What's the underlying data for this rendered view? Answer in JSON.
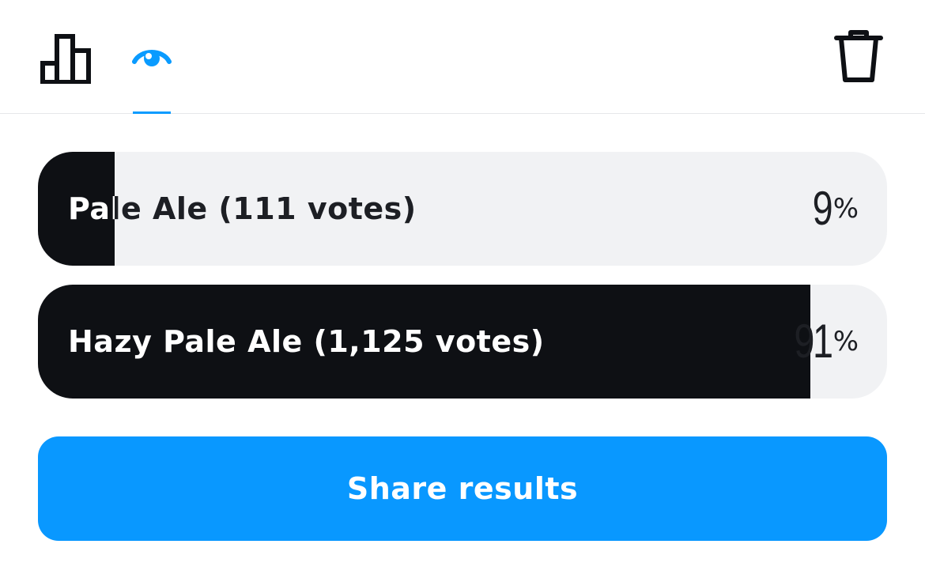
{
  "header": {
    "tabs": [
      {
        "name": "results",
        "icon": "bar-chart-icon",
        "active": false
      },
      {
        "name": "preview",
        "icon": "eye-icon",
        "active": true
      }
    ],
    "delete_icon": "trash-icon",
    "accent": "#0a9bff"
  },
  "poll": {
    "options": [
      {
        "label": "Pale Ale (111 votes)",
        "percent": 9,
        "percent_text": "9",
        "sign": "%"
      },
      {
        "label": "Hazy Pale Ale (1,125 votes)",
        "percent": 91,
        "percent_text": "91",
        "sign": "%"
      }
    ]
  },
  "share": {
    "label": "Share results",
    "color": "#0998ff"
  }
}
